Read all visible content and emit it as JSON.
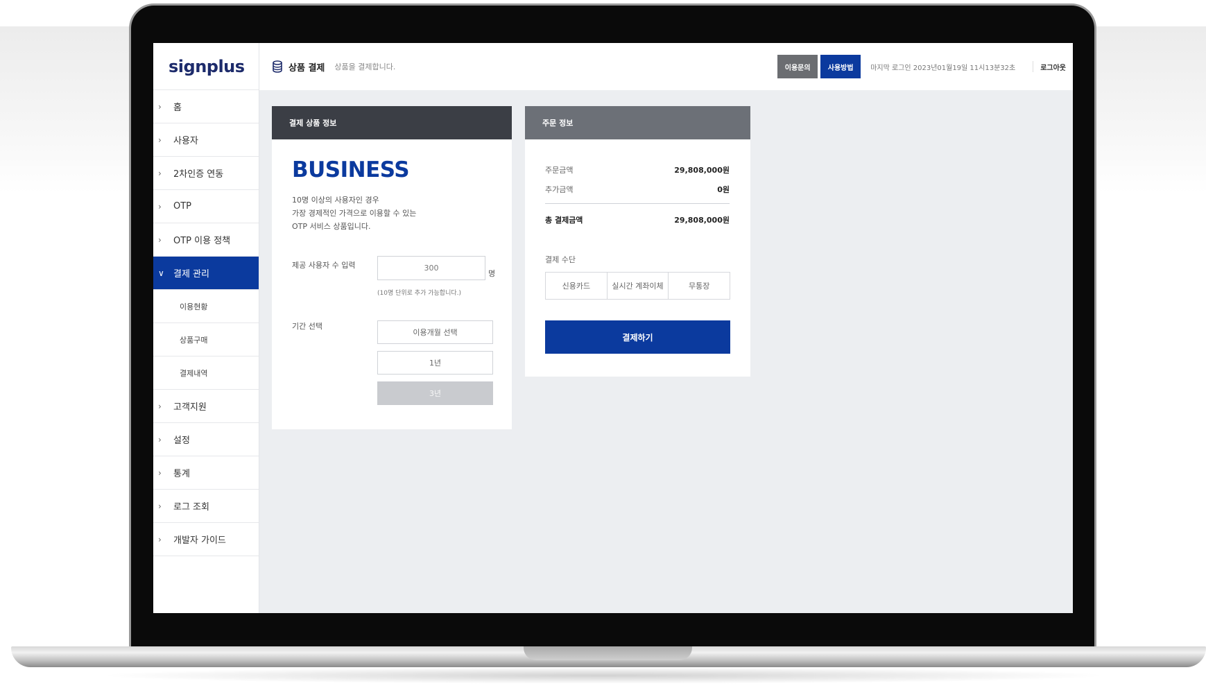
{
  "app": {
    "logo": "signplus"
  },
  "sidebar": {
    "items": [
      {
        "label": "홈"
      },
      {
        "label": "사용자"
      },
      {
        "label": "2차인증 연동"
      },
      {
        "label": "OTP"
      },
      {
        "label": "OTP 이용 정책"
      },
      {
        "label": "결제 관리"
      },
      {
        "label": "고객지원"
      },
      {
        "label": "설정"
      },
      {
        "label": "통계"
      },
      {
        "label": "로그 조회"
      },
      {
        "label": "개발자 가이드"
      }
    ],
    "subitems": [
      {
        "label": "이용현황"
      },
      {
        "label": "상품구매"
      },
      {
        "label": "결제내역"
      }
    ]
  },
  "header": {
    "title": "상품 결제",
    "description": "상품을 결제합니다.",
    "inquiry_label": "이용문의",
    "usage_label": "사용방법",
    "last_login": "마지막 로그인 2023년01월19일 11시13분32초",
    "logout_label": "로그아웃"
  },
  "product": {
    "section_title": "결제 상품 정보",
    "plan_name": "BUSINESS",
    "plan_desc": "10명 이상의 사용자인 경우\n가장 경제적인 가격으로 이용할 수 있는\nOTP 서비스 상품입니다.",
    "users_label": "제공 사용자 수 입력",
    "users_value": "300",
    "users_unit": "명",
    "users_hint": "(10명 단위로 추가 가능합니다.)",
    "period_label": "기간 선택",
    "period_options": [
      "이용개월 선택",
      "1년",
      "3년"
    ],
    "selected_period": "3년"
  },
  "order": {
    "section_title": "주문 정보",
    "order_amount_label": "주문금액",
    "order_amount": "29,808,000원",
    "extra_amount_label": "추가금액",
    "extra_amount": "0원",
    "total_label": "총 결제금액",
    "total_amount": "29,808,000원",
    "payment_method_label": "결제 수단",
    "payment_methods": [
      "신용카드",
      "실시간 계좌이체",
      "무통장"
    ],
    "pay_button": "결제하기"
  },
  "colors": {
    "primary": "#0b3a9e",
    "dark_header": "#3b3e45",
    "gray_header": "#6c7077"
  }
}
